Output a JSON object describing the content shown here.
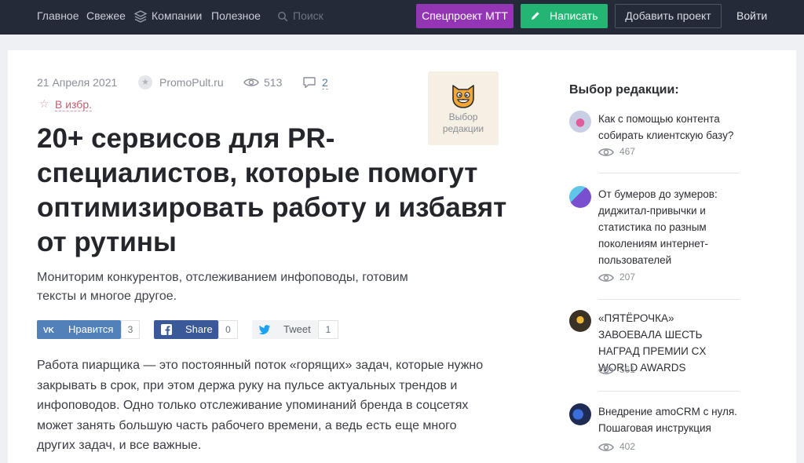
{
  "nav": {
    "links": [
      "Главное",
      "Свежее",
      "Компании",
      "Полезное"
    ],
    "search_placeholder": "Поиск",
    "special_label": "Спецпроект МТТ",
    "write_label": "Написать",
    "add_project_label": "Добавить проект",
    "login_label": "Войти"
  },
  "article": {
    "date": "21 Апреля 2021",
    "source": "PromoPult.ru",
    "views": "513",
    "comments": "2",
    "favorite_label": "В избр.",
    "editor_choice_label": "Выбор\nредакции",
    "title": "20+ сервисов для PR-специалистов, которые помогут оптимизировать работу и избавят от рутины",
    "subtitle": "Мониторим конкурентов, отслеживанием инфоповоды, готовим тексты и многое другое.",
    "body": "Работа пиарщика — это постоянный поток «горящих» задач, которые нужно закрывать в срок, при этом держа руку на пульсе актуальных трендов и инфоповодов. Одно только отслеживание упоминаний бренда в соцсетях может занять большую часть рабочего времени, а ведь есть еще много других задач, и все важные."
  },
  "share": {
    "vk_label": "Нравится",
    "vk_count": "3",
    "fb_label": "Share",
    "fb_count": "0",
    "tw_label": "Tweet",
    "tw_count": "1"
  },
  "sidebar": {
    "title": "Выбор редакции:",
    "items": [
      {
        "text": "Как с помощью контента собирать клиентскую базу?",
        "views": "467"
      },
      {
        "text": "От бумеров до зумеров: диджитал-привычки и статистика по разным поколениям интернет-пользователей",
        "views": "207"
      },
      {
        "text": "«ПЯТЁРОЧКА» ЗАВОЕВАЛА ШЕСТЬ НАГРАД ПРЕМИИ CX WORLD AWARDS",
        "views": "561"
      },
      {
        "text": "Внедрение amoCRM с нуля. Пошаговая инструкция",
        "views": "402"
      }
    ]
  },
  "colors": {
    "topbar": "#242a37",
    "special": "#9335b4",
    "write": "#22b573",
    "vk": "#5181b8",
    "fb": "#3b5998"
  }
}
